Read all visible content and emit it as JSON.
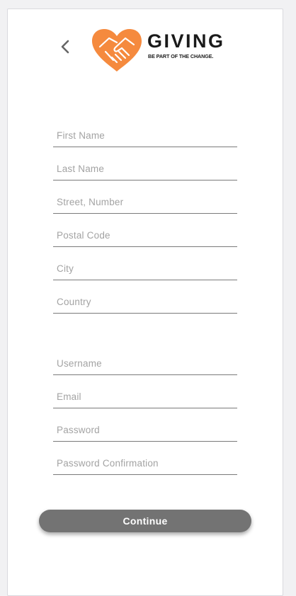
{
  "header": {
    "back_icon": "chevron-left-icon",
    "brand": {
      "title": "GIVING",
      "tagline": "BE PART OF THE CHANGE.",
      "heart_color": "#F58A3E",
      "icon": "heart-handshake-icon"
    }
  },
  "form": {
    "address_fields": {
      "first_name": {
        "placeholder": "First Name",
        "value": ""
      },
      "last_name": {
        "placeholder": "Last Name",
        "value": ""
      },
      "street": {
        "placeholder": "Street, Number",
        "value": ""
      },
      "postal_code": {
        "placeholder": "Postal Code",
        "value": ""
      },
      "city": {
        "placeholder": "City",
        "value": ""
      },
      "country": {
        "placeholder": "Country",
        "value": ""
      }
    },
    "account_fields": {
      "username": {
        "placeholder": "Username",
        "value": ""
      },
      "email": {
        "placeholder": "Email",
        "value": ""
      },
      "password": {
        "placeholder": "Password",
        "value": ""
      },
      "password_confirmation": {
        "placeholder": "Password Confirmation",
        "value": ""
      }
    },
    "continue_label": "Continue",
    "button_color": "#737373"
  }
}
